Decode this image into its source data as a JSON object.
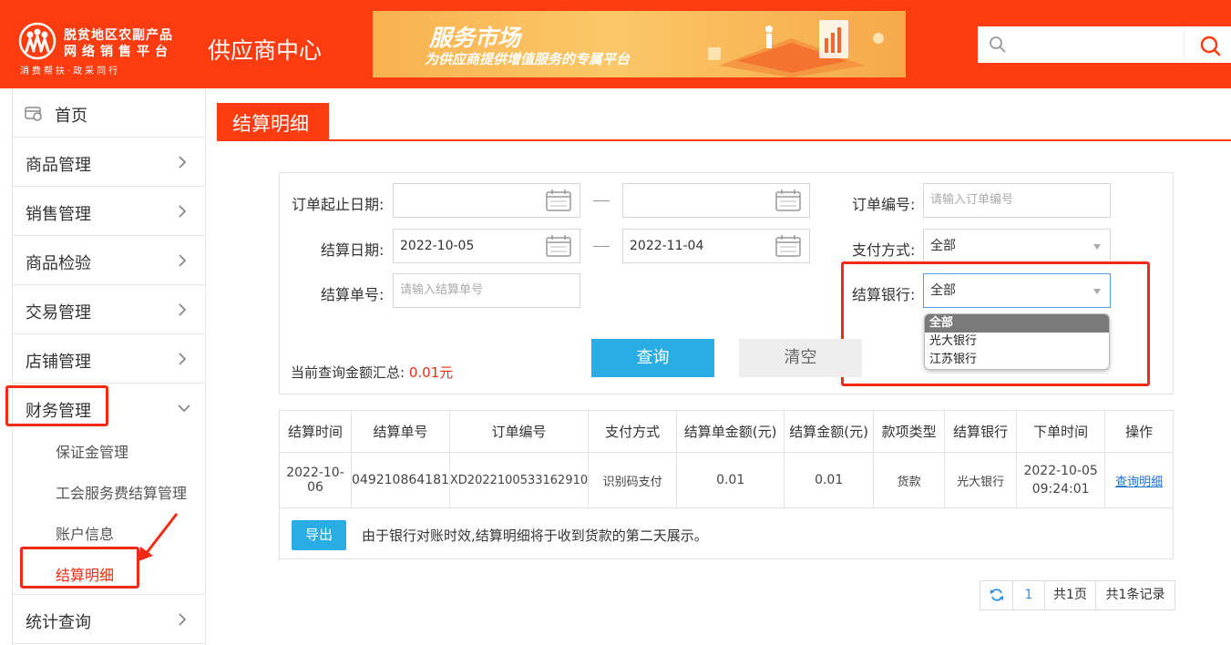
{
  "header": {
    "logo_line1": "脱贫地区农副产品",
    "logo_line2": "网络销售平台",
    "logo_line3": "消费帮扶·政采同行",
    "center_title": "供应商中心",
    "banner_title": "服务市场",
    "banner_subtitle": "为供应商提供增值服务的专属平台",
    "search_placeholder": ""
  },
  "sidebar": {
    "home": "首页",
    "items": [
      "商品管理",
      "销售管理",
      "商品检验",
      "交易管理",
      "店铺管理",
      "财务管理",
      "统计查询"
    ],
    "finance_sub": [
      "保证金管理",
      "工会服务费结算管理",
      "账户信息",
      "结算明细"
    ]
  },
  "main": {
    "title": "结算明细",
    "filters": {
      "order_date_label": "订单起止日期:",
      "order_date_from": "",
      "order_date_to": "",
      "settle_date_label": "结算日期:",
      "settle_date_from": "2022-10-05",
      "settle_date_to": "2022-11-04",
      "settle_no_label": "结算单号:",
      "settle_no_placeholder": "请输入结算单号",
      "order_no_label": "订单编号:",
      "order_no_placeholder": "请输入订单编号",
      "pay_method_label": "支付方式:",
      "pay_method_value": "全部",
      "bank_label": "结算银行:",
      "bank_value": "全部",
      "bank_options": [
        "全部",
        "光大银行",
        "江苏银行"
      ]
    },
    "query_button": "查询",
    "clear_button": "清空",
    "summary_label": "当前查询金额汇总:",
    "summary_value": "0.01元",
    "table": {
      "headers": [
        "结算时间",
        "结算单号",
        "订单编号",
        "支付方式",
        "结算单金额(元)",
        "结算金额(元)",
        "款项类型",
        "结算银行",
        "下单时间",
        "操作"
      ],
      "rows": [
        [
          "2022-10-06",
          "049210864181",
          "XD2022100533162910",
          "识别码支付",
          "0.01",
          "0.01",
          "货款",
          "光大银行",
          "2022-10-05 09:24:01",
          "查询明细"
        ]
      ]
    },
    "export_button": "导出",
    "export_note": "由于银行对账时效,结算明细将于收到货款的第二天展示。",
    "pager": {
      "page": "1",
      "total_pages": "共1页",
      "total_records": "共1条记录"
    }
  },
  "colors": {
    "brand": "#fe3c0f",
    "accent": "#2aace5",
    "highlight": "#ef2b14"
  }
}
